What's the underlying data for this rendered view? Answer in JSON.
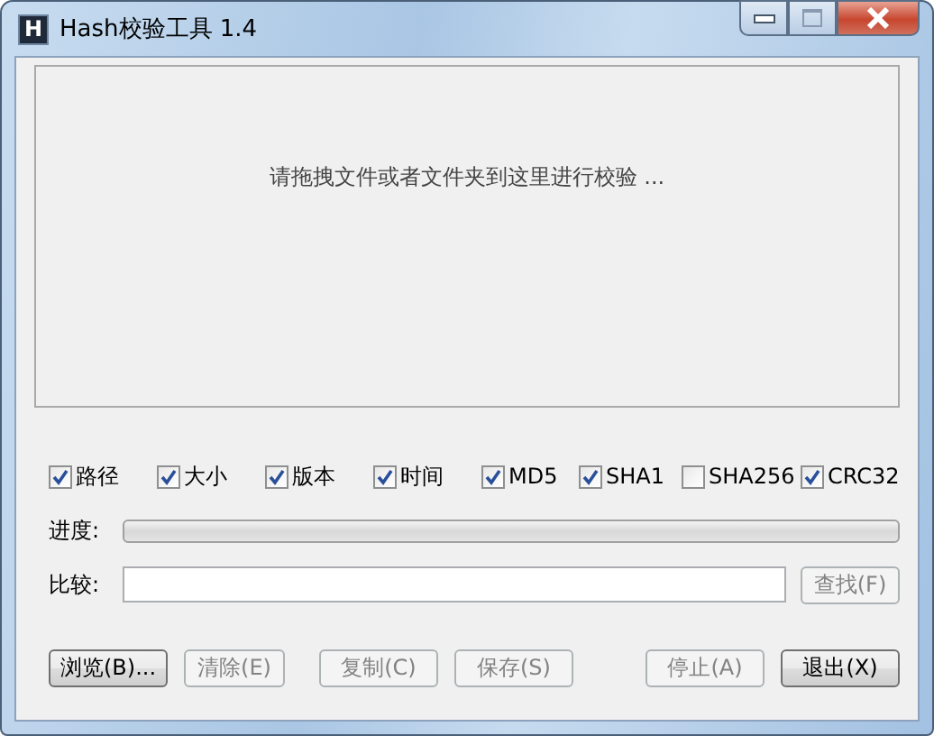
{
  "window": {
    "title": "Hash校验工具 1.4",
    "logo": "H"
  },
  "drop_area": {
    "hint": "请拖拽文件或者文件夹到这里进行校验 ..."
  },
  "options": [
    {
      "label": "路径",
      "checked": true
    },
    {
      "label": "大小",
      "checked": true
    },
    {
      "label": "版本",
      "checked": true
    },
    {
      "label": "时间",
      "checked": true
    },
    {
      "label": "MD5",
      "checked": true
    },
    {
      "label": "SHA1",
      "checked": true
    },
    {
      "label": "SHA256",
      "checked": false
    },
    {
      "label": "CRC32",
      "checked": true
    }
  ],
  "progress": {
    "label": "进度:",
    "level": 0
  },
  "compare": {
    "label": "比较:",
    "find_button": {
      "label": "查找(F)",
      "disabled": true
    }
  },
  "buttons": [
    {
      "label": "浏览(B)...",
      "disabled": false,
      "kind": "left"
    },
    {
      "label": "清除(E)",
      "disabled": true,
      "kind": "left"
    },
    {
      "label": "复制(C)",
      "disabled": true,
      "kind": "left"
    },
    {
      "label": "保存(S)",
      "disabled": true,
      "kind": "left"
    },
    {
      "label": "停止(A)",
      "disabled": true,
      "kind": "right"
    },
    {
      "label": "退出(X)",
      "disabled": false,
      "kind": "right"
    }
  ]
}
